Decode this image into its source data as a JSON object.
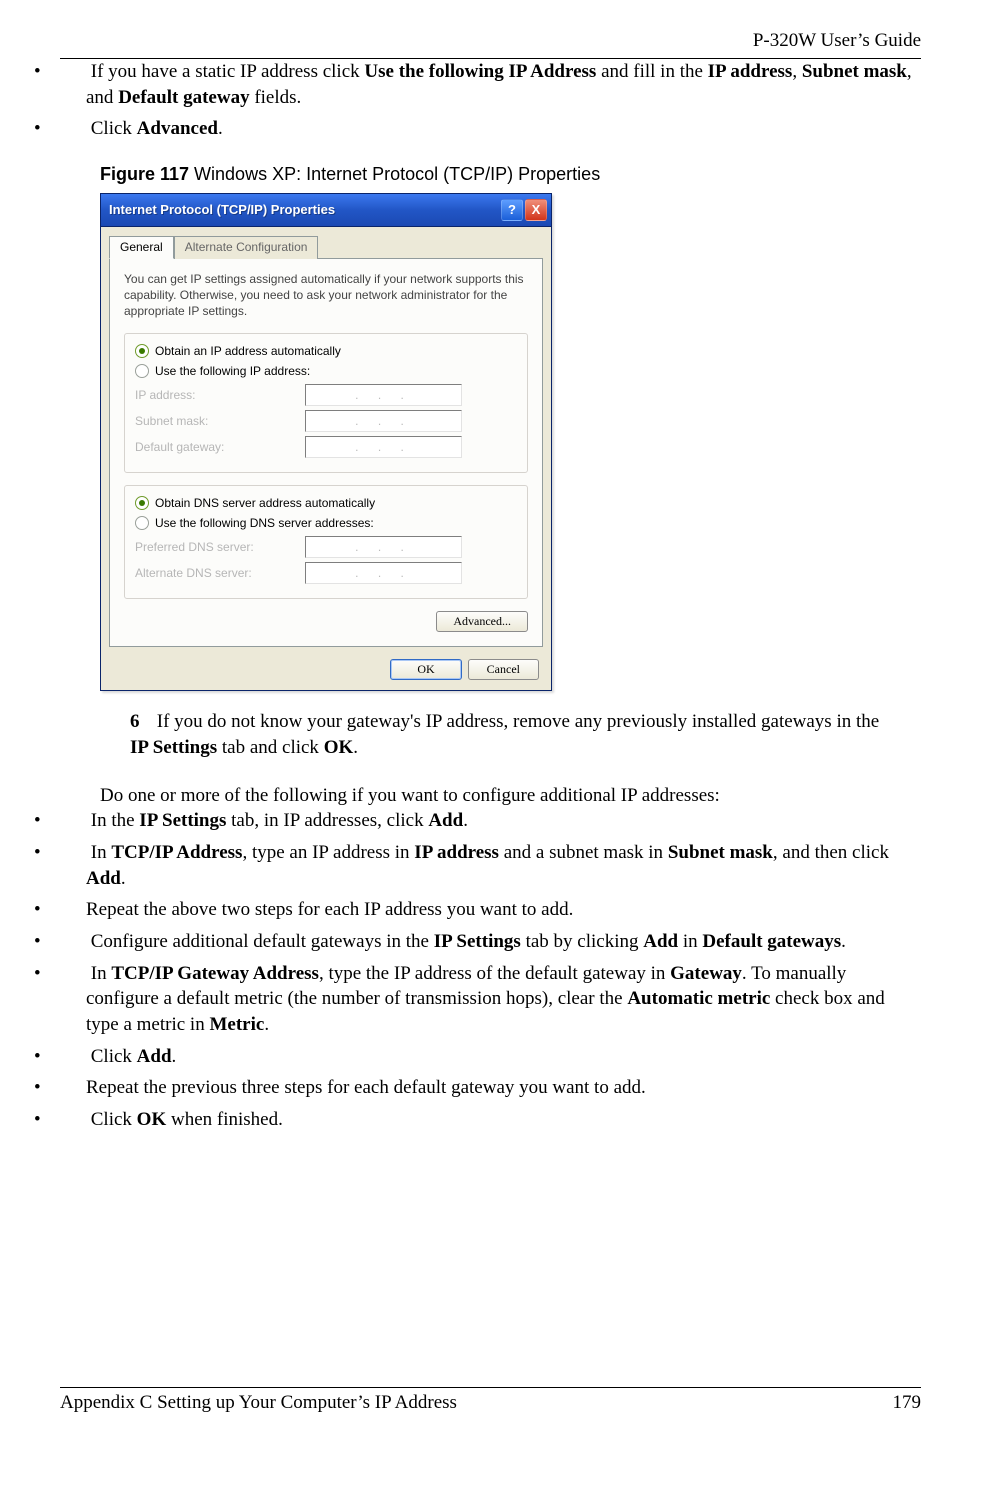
{
  "header": {
    "guide_title": "P-320W User’s Guide"
  },
  "top_bullets": {
    "b1_pre": "If you have a static IP address click ",
    "b1_bold1": "Use the following IP Address",
    "b1_mid1": " and fill in the ",
    "b1_bold2": "IP address",
    "b1_mid2": ", ",
    "b1_bold3": "Subnet mask",
    "b1_mid3": ", and ",
    "b1_bold4": "Default gateway",
    "b1_post": " fields.",
    "b2_pre": "Click ",
    "b2_bold": "Advanced",
    "b2_post": "."
  },
  "figure": {
    "label": "Figure 117",
    "caption": "   Windows XP: Internet Protocol (TCP/IP) Properties"
  },
  "dialog": {
    "title": "Internet Protocol (TCP/IP) Properties",
    "help_symbol": "?",
    "close_symbol": "X",
    "tabs": {
      "general": "General",
      "alt": "Alternate Configuration"
    },
    "desc": "You can get IP settings assigned automatically if your network supports this capability. Otherwise, you need to ask your network administrator for the appropriate IP settings.",
    "radios": {
      "obtain_ip": "Obtain an IP address automatically",
      "use_ip": "Use the following IP address:",
      "obtain_dns": "Obtain DNS server address automatically",
      "use_dns": "Use the following DNS server addresses:"
    },
    "fields": {
      "ip": "IP address:",
      "subnet": "Subnet mask:",
      "gateway": "Default gateway:",
      "pref_dns": "Preferred DNS server:",
      "alt_dns": "Alternate DNS server:"
    },
    "ip_dots": ".       .       .",
    "buttons": {
      "advanced": "Advanced...",
      "ok": "OK",
      "cancel": "Cancel"
    }
  },
  "step6": {
    "num": "6",
    "t1": "If you do not know your gateway's IP address, remove any previously installed gateways in the ",
    "b1": "IP Settings",
    "t2": " tab and click ",
    "b2": "OK",
    "t3": "."
  },
  "para_additional": "Do one or more of the following if you want to configure additional IP addresses:",
  "bottom_bullets": {
    "i1_t1": "In the ",
    "i1_b1": "IP Settings",
    "i1_t2": " tab, in IP addresses, click ",
    "i1_b2": "Add",
    "i1_t3": ".",
    "i2_t1": "In ",
    "i2_b1": "TCP/IP Address",
    "i2_t2": ", type an IP address in ",
    "i2_b2": "IP address",
    "i2_t3": " and a subnet mask in ",
    "i2_b3": "Subnet mask",
    "i2_t4": ", and then click ",
    "i2_b4": "Add",
    "i2_t5": ".",
    "i3": "Repeat the above two steps for each IP address you want to add.",
    "i4_t1": "Configure additional default gateways in the ",
    "i4_b1": "IP Settings",
    "i4_t2": " tab by clicking ",
    "i4_b2": "Add",
    "i4_t3": " in ",
    "i4_b3": "Default gateways",
    "i4_t4": ".",
    "i5_t1": "In ",
    "i5_b1": "TCP/IP Gateway Address",
    "i5_t2": ", type the IP address of the default gateway in ",
    "i5_b2": "Gateway",
    "i5_t3": ". To manually configure a default metric (the number of transmission hops), clear the ",
    "i5_b3": "Automatic metric",
    "i5_t4": " check box and type a metric in ",
    "i5_b4": "Metric",
    "i5_t5": ".",
    "i6_t1": "Click ",
    "i6_b1": "Add",
    "i6_t2": ".",
    "i7": "Repeat the previous three steps for each default gateway you want to add.",
    "i8_t1": "Click ",
    "i8_b1": "OK",
    "i8_t2": " when finished."
  },
  "footer": {
    "appendix": "Appendix C Setting up Your Computer’s IP Address",
    "page": "179"
  }
}
